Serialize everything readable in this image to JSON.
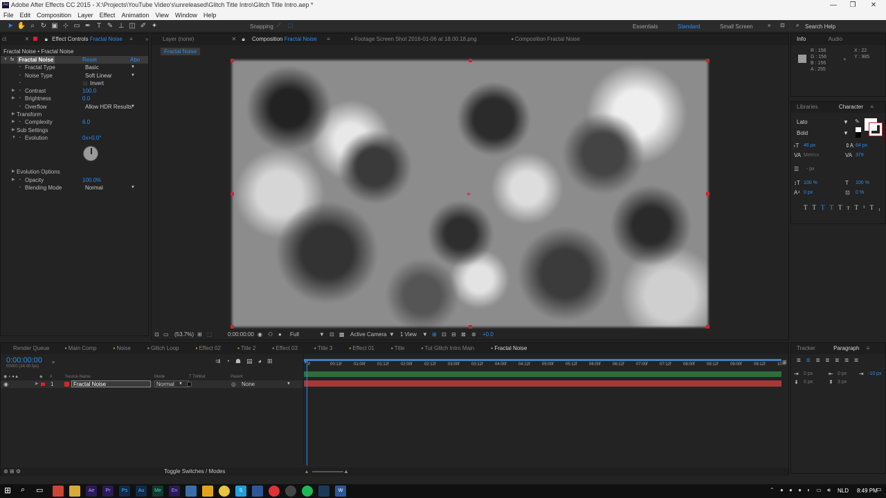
{
  "window": {
    "title": "Adobe After Effects CC 2015 - X:\\Projects\\YouTube Video's\\unreleased\\Glitch Title Intro\\Glitch Title Intro.aep *",
    "app_icon": "Ae",
    "min": "—",
    "max": "❐",
    "close": "✕"
  },
  "menu": [
    "File",
    "Edit",
    "Composition",
    "Layer",
    "Effect",
    "Animation",
    "View",
    "Window",
    "Help"
  ],
  "toolbar": {
    "snapping": "Snapping",
    "workspaces": [
      "Essentials",
      "Standard",
      "Small Screen"
    ],
    "more": "»",
    "search_help": "Search Help"
  },
  "left_panel": {
    "tab_stub": "ct",
    "tab_label": "Effect Controls",
    "tab_target": "Fractal Noise",
    "breadcrumb": "Fractal Noise • Fractal Noise",
    "effect": {
      "name": "Fractal Noise",
      "reset": "Reset",
      "about": "Abo"
    },
    "props": [
      {
        "label": "Fractal Type",
        "value": "Basic",
        "kind": "select"
      },
      {
        "label": "Noise Type",
        "value": "Soft Linear",
        "kind": "select"
      },
      {
        "label": "",
        "value": "Invert",
        "kind": "checkbox"
      },
      {
        "label": "Contrast",
        "value": "100.0",
        "kind": "num"
      },
      {
        "label": "Brightness",
        "value": "0.0",
        "kind": "num"
      },
      {
        "label": "Overflow",
        "value": "Allow HDR Results",
        "kind": "select"
      },
      {
        "label": "Transform",
        "value": "",
        "kind": "group"
      },
      {
        "label": "Complexity",
        "value": "6.0",
        "kind": "num"
      },
      {
        "label": "Sub Settings",
        "value": "",
        "kind": "group"
      },
      {
        "label": "Evolution",
        "value": "0x+0.0°",
        "kind": "num"
      }
    ],
    "props2": [
      {
        "label": "Evolution Options",
        "value": "",
        "kind": "group"
      },
      {
        "label": "Opacity",
        "value": "100.0%",
        "kind": "num"
      },
      {
        "label": "Blending Mode",
        "value": "Normal",
        "kind": "select"
      }
    ]
  },
  "viewer": {
    "tabs": [
      {
        "label": "Layer (none)"
      },
      {
        "label": "Composition",
        "target": "Fractal Noise"
      },
      {
        "label": "Footage Screen Shot 2016-01-06 at 18.00.18.png"
      },
      {
        "label": "Composition Fractal Noise"
      }
    ],
    "comp_name": "Fractal Noise",
    "footer": {
      "zoom": "(53.7%)",
      "time": "0:00:00:00",
      "resolution": "Full",
      "camera": "Active Camera",
      "view": "1 View",
      "exposure": "+0.0"
    }
  },
  "info": {
    "tabs": [
      "Info",
      "Audio"
    ],
    "r": "R : 156",
    "g": "G : 156",
    "b": "B : 156",
    "a": "A : 255",
    "x": "X : 22",
    "y": "Y : 985",
    "swatch": "#9c9c9c"
  },
  "character": {
    "tabs": [
      "Libraries",
      "Character"
    ],
    "font": "Lato",
    "style": "Bold",
    "size": "46 px",
    "leading": "64 px",
    "kerning": "Metrics",
    "tracking": "379",
    "stroke_unit": "- px",
    "vscale": "100 %",
    "hscale": "100 %",
    "baseline": "0 px",
    "tsume": "0 %",
    "styles": [
      "T",
      "T",
      "TT",
      "Tᴛ",
      "T¹",
      "T₁"
    ]
  },
  "paragraph": {
    "tabs": [
      "Tracker",
      "Paragraph"
    ],
    "indent_left": "0 px",
    "indent_right": "0 px",
    "indent_first": "-10 px",
    "space_before": "0 px",
    "space_after": "3 px"
  },
  "timeline": {
    "tabs": [
      "Render Queue",
      "Main Comp",
      "Noise",
      "Glitch Loop",
      "Effect 02",
      "Title 2",
      "Effect 03",
      "Title 3",
      "Effect 01",
      "Title",
      "Tut Glitch Intro Main",
      "Fractal Noise"
    ],
    "timecode": "0:00:00:00",
    "fps": "00000 (24.00 fps)",
    "columns": {
      "source": "Source Name",
      "mode": "Mode",
      "trkmat": "T TrkMat",
      "parent": "Parent"
    },
    "ruler": [
      "0f",
      "00:12f",
      "01:00f",
      "01:12f",
      "02:00f",
      "02:12f",
      "03:00f",
      "03:12f",
      "04:00f",
      "04:12f",
      "05:00f",
      "05:12f",
      "06:00f",
      "06:12f",
      "07:00f",
      "07:12f",
      "08:00f",
      "08:12f",
      "09:00f",
      "09:12f",
      "10:0"
    ],
    "layers": [
      {
        "num": "1",
        "name": "Fractal Noise",
        "mode": "Normal",
        "parent": "None",
        "color": "#d2262b"
      }
    ],
    "toggle": "Toggle Switches / Modes"
  },
  "taskbar": {
    "lang": "NLD",
    "time": "8:49 PM"
  }
}
